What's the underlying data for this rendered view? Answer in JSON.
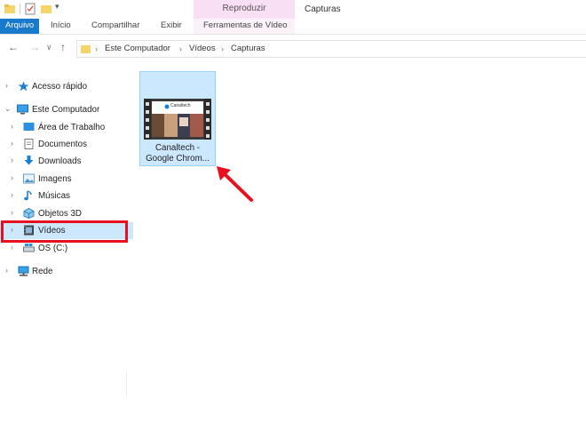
{
  "ribbon": {
    "file_tab": "Arquivo",
    "tabs": [
      "Início",
      "Compartilhar",
      "Exibir"
    ],
    "contextual_group": "Reproduzir",
    "contextual_tab": "Ferramentas de Vídeo"
  },
  "window": {
    "title": "Capturas"
  },
  "address": {
    "crumbs": [
      "Este Computador",
      "Vídeos",
      "Capturas"
    ]
  },
  "nav": {
    "quick_access": "Acesso rápido",
    "this_pc": "Este Computador",
    "children": [
      "Área de Trabalho",
      "Documentos",
      "Downloads",
      "Imagens",
      "Músicas",
      "Objetos 3D",
      "Vídeos",
      "OS (C:)"
    ],
    "network": "Rede"
  },
  "files": [
    {
      "name_line1": "Canaltech -",
      "name_line2": "Google Chrom...",
      "type_icon": "video-file-icon"
    }
  ],
  "thumbnail": {
    "brand": "Canaltech"
  },
  "colors": {
    "accent": "#1979ca",
    "contextual_tab_bg": "#f8dff3",
    "selection_bg": "#cce8ff",
    "highlight_box": "#e8101e"
  }
}
